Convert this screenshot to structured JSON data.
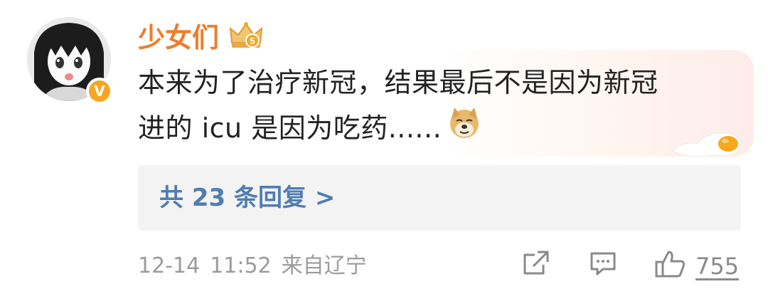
{
  "comment": {
    "username": "少女们",
    "badge_level": "5",
    "verified_mark": "V",
    "text_line1": "本来为了治疗新冠，结果最后不是因为新冠",
    "text_line2": "进的 icu 是因为吃药......",
    "emoji": "doge-icon"
  },
  "replies": {
    "label": "共 23 条回复 >"
  },
  "meta": {
    "date": "12-14",
    "time": "11:52",
    "source": "来自辽宁"
  },
  "actions": {
    "share_icon": "share-icon",
    "comment_icon": "comment-icon",
    "like_icon": "thumbs-up-icon",
    "like_count": "755"
  },
  "colors": {
    "username": "#ee7d2c",
    "link": "#507daf",
    "meta": "#9b9b9b",
    "badge": "#f5a623"
  }
}
